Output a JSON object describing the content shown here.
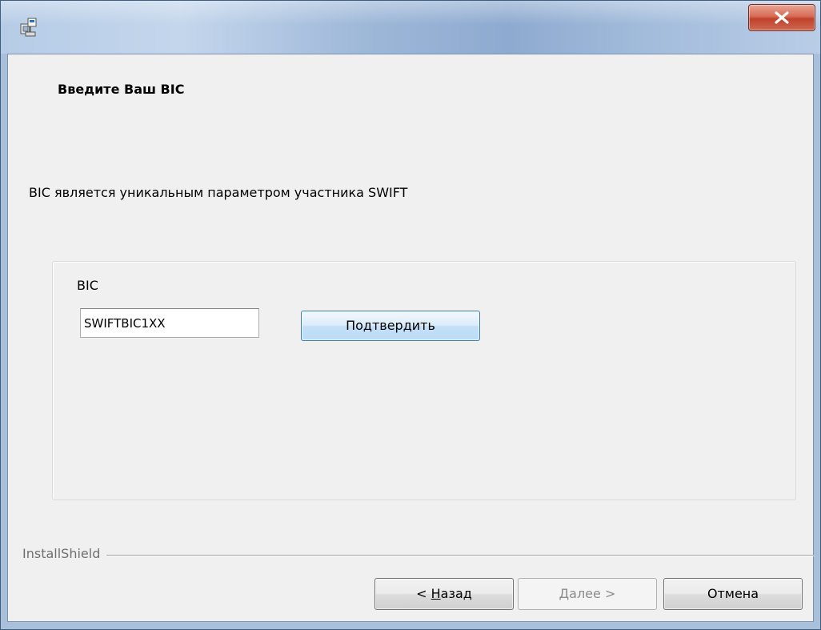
{
  "window": {
    "icon": "installer-icon",
    "close_icon": "close-icon"
  },
  "page": {
    "heading": "Введите Ваш BIC",
    "description": "BIC является уникальным параметром участника SWIFT"
  },
  "form": {
    "bic_label": "BIC",
    "bic_value": "SWIFTBIC1XX",
    "confirm_label": "Подтвердить"
  },
  "footer": {
    "brand": "InstallShield",
    "back": {
      "mnemonic": "Н",
      "rest": "азад",
      "prefix": "< "
    },
    "next": {
      "mnemonic": "Д",
      "rest": "алее >",
      "prefix": ""
    },
    "cancel": "Отмена"
  },
  "colors": {
    "close_button": "#c0412b",
    "confirm_button_border": "#3c7fb1"
  }
}
